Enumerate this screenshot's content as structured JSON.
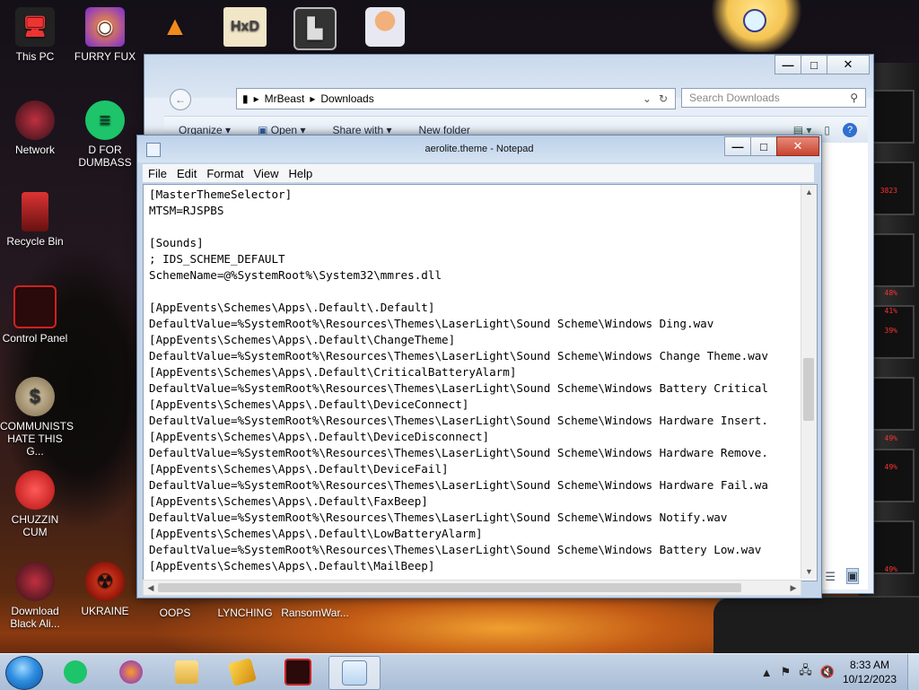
{
  "desktop": {
    "icons": [
      {
        "label": "This PC"
      },
      {
        "label": "FURRY FUX"
      },
      {
        "label": "Network"
      },
      {
        "label": "D FOR DUMBASS"
      },
      {
        "label": "Recycle Bin"
      },
      {
        "label": "Control Panel"
      },
      {
        "label": "COMMUNISTS HATE THIS G..."
      },
      {
        "label": "CHUZZIN CUM"
      },
      {
        "label": "Download Black Ali..."
      },
      {
        "label": "UKRAINE"
      },
      {
        "label": "OOPS"
      },
      {
        "label": "LYNCHING"
      },
      {
        "label": "RansomWar..."
      }
    ],
    "alien_readouts": [
      "3823",
      "48%",
      "41%",
      "39%",
      "49%",
      "49%",
      "49%"
    ]
  },
  "explorer": {
    "path": [
      "MrBeast",
      "Downloads"
    ],
    "search_placeholder": "Search Downloads",
    "toolbar": {
      "organize": "Organize",
      "open": "Open",
      "share": "Share with",
      "new_folder": "New folder"
    }
  },
  "notepad": {
    "title": "aerolite.theme - Notepad",
    "menu": [
      "File",
      "Edit",
      "Format",
      "View",
      "Help"
    ],
    "lines": [
      "[MasterThemeSelector]",
      "MTSM=RJSPBS",
      "",
      "[Sounds]",
      "; IDS_SCHEME_DEFAULT",
      "SchemeName=@%SystemRoot%\\System32\\mmres.dll",
      "",
      "[AppEvents\\Schemes\\Apps\\.Default\\.Default]",
      "DefaultValue=%SystemRoot%\\Resources\\Themes\\LaserLight\\Sound Scheme\\Windows Ding.wav",
      "[AppEvents\\Schemes\\Apps\\.Default\\ChangeTheme]",
      "DefaultValue=%SystemRoot%\\Resources\\Themes\\LaserLight\\Sound Scheme\\Windows Change Theme.wav",
      "[AppEvents\\Schemes\\Apps\\.Default\\CriticalBatteryAlarm]",
      "DefaultValue=%SystemRoot%\\Resources\\Themes\\LaserLight\\Sound Scheme\\Windows Battery Critical",
      "[AppEvents\\Schemes\\Apps\\.Default\\DeviceConnect]",
      "DefaultValue=%SystemRoot%\\Resources\\Themes\\LaserLight\\Sound Scheme\\Windows Hardware Insert.",
      "[AppEvents\\Schemes\\Apps\\.Default\\DeviceDisconnect]",
      "DefaultValue=%SystemRoot%\\Resources\\Themes\\LaserLight\\Sound Scheme\\Windows Hardware Remove.",
      "[AppEvents\\Schemes\\Apps\\.Default\\DeviceFail]",
      "DefaultValue=%SystemRoot%\\Resources\\Themes\\LaserLight\\Sound Scheme\\Windows Hardware Fail.wa",
      "[AppEvents\\Schemes\\Apps\\.Default\\FaxBeep]",
      "DefaultValue=%SystemRoot%\\Resources\\Themes\\LaserLight\\Sound Scheme\\Windows Notify.wav",
      "[AppEvents\\Schemes\\Apps\\.Default\\LowBatteryAlarm]",
      "DefaultValue=%SystemRoot%\\Resources\\Themes\\LaserLight\\Sound Scheme\\Windows Battery Low.wav",
      "[AppEvents\\Schemes\\Apps\\.Default\\MailBeep]"
    ]
  },
  "taskbar": {
    "clock_time": "8:33 AM",
    "clock_date": "10/12/2023"
  },
  "colors": {
    "accent_blue": "#2f8ee0",
    "alien_red": "#ff3030"
  }
}
